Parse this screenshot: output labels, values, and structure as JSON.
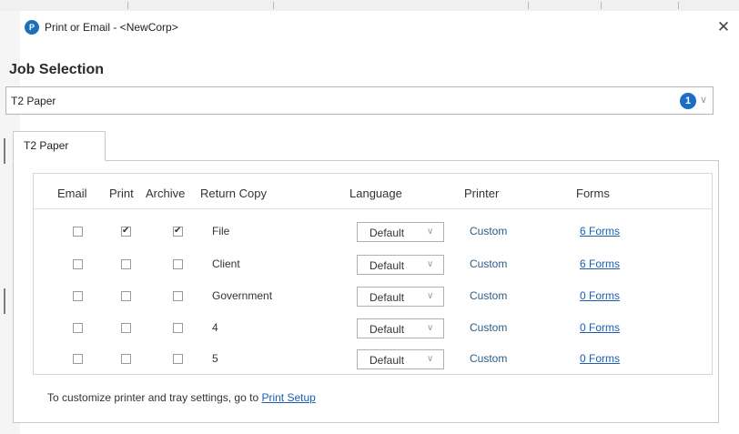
{
  "window": {
    "title": "Print or Email - <NewCorp>",
    "logo_letter": "P",
    "close_glyph": "✕"
  },
  "job_selection": {
    "heading": "Job Selection",
    "selected": "T2 Paper",
    "badge": "1",
    "chevron_icon": "chevron-down-icon"
  },
  "tabs": [
    {
      "label": "T2 Paper",
      "active": true
    }
  ],
  "table": {
    "columns": [
      "Email",
      "Print",
      "Archive",
      "Return Copy",
      "Language",
      "Printer",
      "Forms"
    ],
    "rows": [
      {
        "email": false,
        "print": true,
        "archive": true,
        "return_copy": "File",
        "language": "Default",
        "printer": "Custom",
        "forms": "6 Forms"
      },
      {
        "email": false,
        "print": false,
        "archive": false,
        "return_copy": "Client",
        "language": "Default",
        "printer": "Custom",
        "forms": "6 Forms"
      },
      {
        "email": false,
        "print": false,
        "archive": false,
        "return_copy": "Government",
        "language": "Default",
        "printer": "Custom",
        "forms": "0 Forms"
      },
      {
        "email": false,
        "print": false,
        "archive": false,
        "return_copy": "4",
        "language": "Default",
        "printer": "Custom",
        "forms": "0 Forms"
      },
      {
        "email": false,
        "print": false,
        "archive": false,
        "return_copy": "5",
        "language": "Default",
        "printer": "Custom",
        "forms": "0 Forms"
      }
    ]
  },
  "footer": {
    "text": "To customize printer and tray settings, go to ",
    "link": "Print Setup"
  },
  "colors": {
    "accent": "#1d6dc4",
    "link": "#1a5fb4",
    "printer_text": "#2b5c8a"
  }
}
